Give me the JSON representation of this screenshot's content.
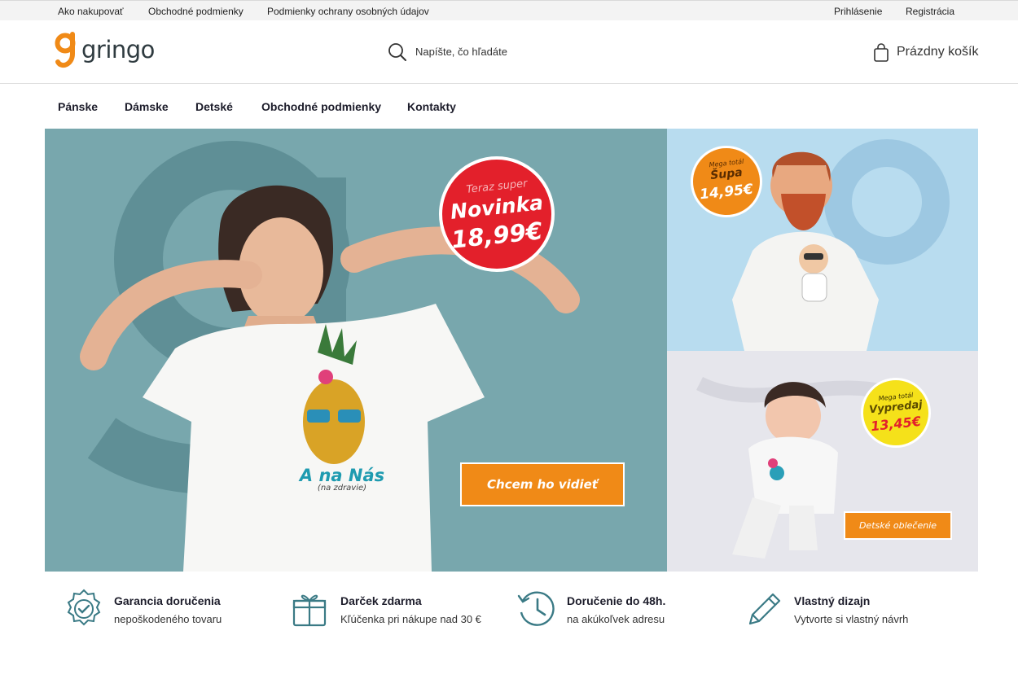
{
  "topbar": {
    "links": [
      "Ako nakupovať",
      "Obchodné podmienky",
      "Podmienky ochrany osobných údajov"
    ],
    "login": "Prihlásenie",
    "register": "Registrácia"
  },
  "header": {
    "logo_text": "gringo",
    "search_placeholder": "Napíšte, čo hľadáte",
    "cart_label": "Prázdny košík"
  },
  "nav": [
    "Pánske",
    "Dámske",
    "Detské",
    "Obchodné podmienky",
    "Kontakty"
  ],
  "hero": {
    "main_badge": {
      "line1": "Teraz super",
      "line2": "Novinka",
      "price": "18,99€"
    },
    "shirt_text": {
      "line1": "A na Nás",
      "line2": "(na zdravie)"
    },
    "main_cta": "Chcem ho vidieť",
    "side1_badge": {
      "line1": "Mega totál",
      "line2": "Šupa",
      "price": "14,95€"
    },
    "side2_badge": {
      "line1": "Mega totál",
      "line2": "Vypredaj",
      "price": "13,45€"
    },
    "kids_cta": "Detské oblečenie"
  },
  "features": [
    {
      "icon": "badge-check-icon",
      "title": "Garancia doručenia",
      "subtitle": "nepoškodeného tovaru"
    },
    {
      "icon": "gift-icon",
      "title": "Darček zdarma",
      "subtitle": "Kľúčenka pri nákupe nad 30 €"
    },
    {
      "icon": "clock-history-icon",
      "title": "Doručenie do 48h.",
      "subtitle": "na akúkoľvek adresu"
    },
    {
      "icon": "pencil-icon",
      "title": "Vlastný dizajn",
      "subtitle": "Vytvorte si vlastný návrh"
    }
  ],
  "colors": {
    "brand_orange": "#f08a17",
    "accent_red": "#e3202b",
    "accent_yellow": "#f5e11a",
    "icon_teal": "#3a7a85"
  }
}
